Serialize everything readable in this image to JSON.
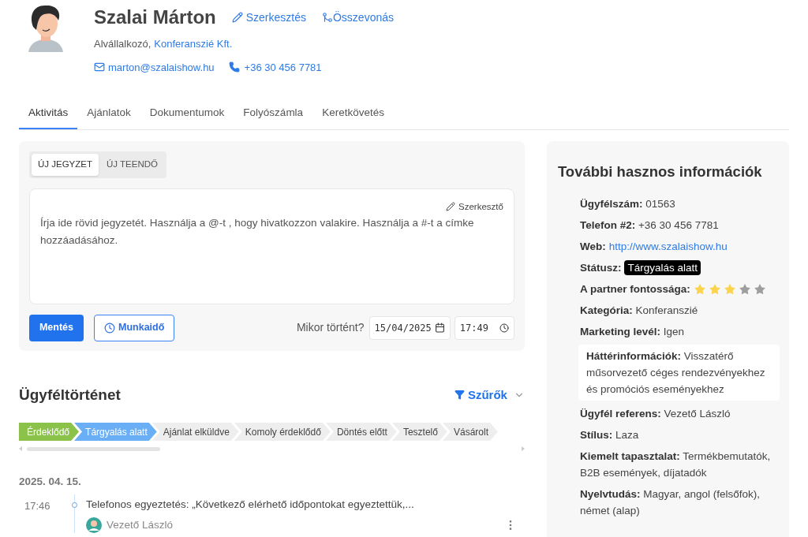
{
  "profile": {
    "name": "Szalai Márton",
    "edit_link": "Szerkesztés",
    "merge_link": "Összevonás",
    "role": "Alvállalkozó,",
    "company": "Konferanszié Kft.",
    "email": "marton@szalaishow.hu",
    "phone": "+36 30 456 7781"
  },
  "tabs": [
    {
      "label": "Aktivitás",
      "selected": true
    },
    {
      "label": "Ajánlatok",
      "selected": false
    },
    {
      "label": "Dokumentumok",
      "selected": false
    },
    {
      "label": "Folyószámla",
      "selected": false
    },
    {
      "label": "Keretkövetés",
      "selected": false
    }
  ],
  "composer": {
    "modes": [
      {
        "label": "ÚJ JEGYZET",
        "selected": true
      },
      {
        "label": "ÚJ TEENDŐ",
        "selected": false
      }
    ],
    "editor_link": "Szerkesztő",
    "placeholder": "Írja ide rövid jegyzetét. Használja a @-t , hogy hivatkozzon valakire. Használja a #-t a címke hozzáadásához.",
    "save_button": "Mentés",
    "worktime_button": "Munkaidő",
    "when_label": "Mikor történt?",
    "date": "15/04/2025",
    "time": "17:49"
  },
  "history": {
    "title": "Ügyféltörténet",
    "filter_button": "Szűrők",
    "stages": [
      {
        "label": "Érdeklődő",
        "completed": true,
        "selected": false
      },
      {
        "label": "Tárgyalás alatt",
        "completed": false,
        "selected": true
      },
      {
        "label": "Ajánlat elküldve",
        "completed": false,
        "selected": false
      },
      {
        "label": "Komoly érdeklődő",
        "completed": false,
        "selected": false
      },
      {
        "label": "Döntés előtt",
        "completed": false,
        "selected": false
      },
      {
        "label": "Tesztelő",
        "completed": false,
        "selected": false
      },
      {
        "label": "Vásárolt",
        "completed": false,
        "selected": false
      }
    ],
    "days": [
      {
        "date": "2025. 04. 15.",
        "entries": [
          {
            "time": "17:46",
            "text": "Telefonos egyeztetés: „Következő elérhető időpontokat egyeztettük,...",
            "author": "Vezető László"
          }
        ]
      }
    ]
  },
  "info": {
    "title": "További hasznos információk",
    "rows": [
      {
        "kind": "text",
        "label": "Ügyfélszám:",
        "value": "01563"
      },
      {
        "kind": "text",
        "label": "Telefon #2:",
        "value": "+36 30 456 7781"
      },
      {
        "kind": "link",
        "label": "Web:",
        "value": "http://www.szalaishow.hu"
      },
      {
        "kind": "badge",
        "label": "Státusz:",
        "value": "Tárgyalás alatt"
      },
      {
        "kind": "stars",
        "label": "A partner fontossága:",
        "stars": 3
      },
      {
        "kind": "text",
        "label": "Kategória:",
        "value": "Konferanszié"
      },
      {
        "kind": "text",
        "label": "Marketing levél:",
        "value": "Igen"
      },
      {
        "kind": "boxed",
        "label": "Háttérinformációk:",
        "value": "Visszatérő műsorvezető céges rendezvényekhez és promóciós eseményekhez"
      },
      {
        "kind": "text",
        "label": "Ügyfél referens:",
        "value": "Vezető László"
      },
      {
        "kind": "text",
        "label": "Stílus:",
        "value": "Laza"
      },
      {
        "kind": "text",
        "label": "Kiemelt tapasztalat:",
        "value": "Termékbemutatók, B2B események, díjatadók"
      },
      {
        "kind": "text",
        "label": "Nyelvtudás:",
        "value": "Magyar, angol (felsőfok), német (alap)"
      }
    ]
  }
}
